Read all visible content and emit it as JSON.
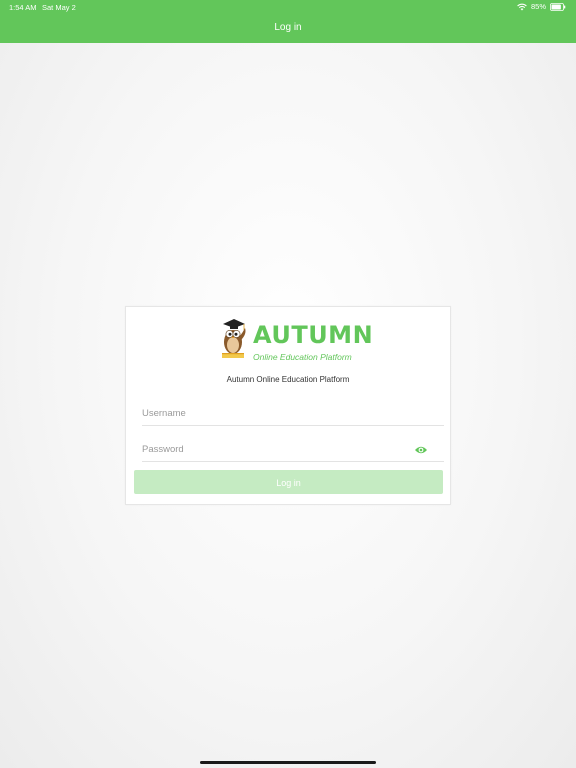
{
  "status_bar": {
    "time": "1:54 AM",
    "date": "Sat May 2",
    "battery": "85%",
    "battery_level": 0.85
  },
  "nav": {
    "title": "Log in"
  },
  "logo": {
    "title": "AUTUMN",
    "tagline": "Online Education Platform"
  },
  "card": {
    "subtitle": "Autumn Online Education Platform"
  },
  "form": {
    "username_placeholder": "Username",
    "username_value": "",
    "password_placeholder": "Password",
    "password_value": "",
    "login_label": "Log in",
    "login_enabled": false
  },
  "colors": {
    "accent": "#62c65a",
    "button_disabled": "#c5ebc2"
  }
}
